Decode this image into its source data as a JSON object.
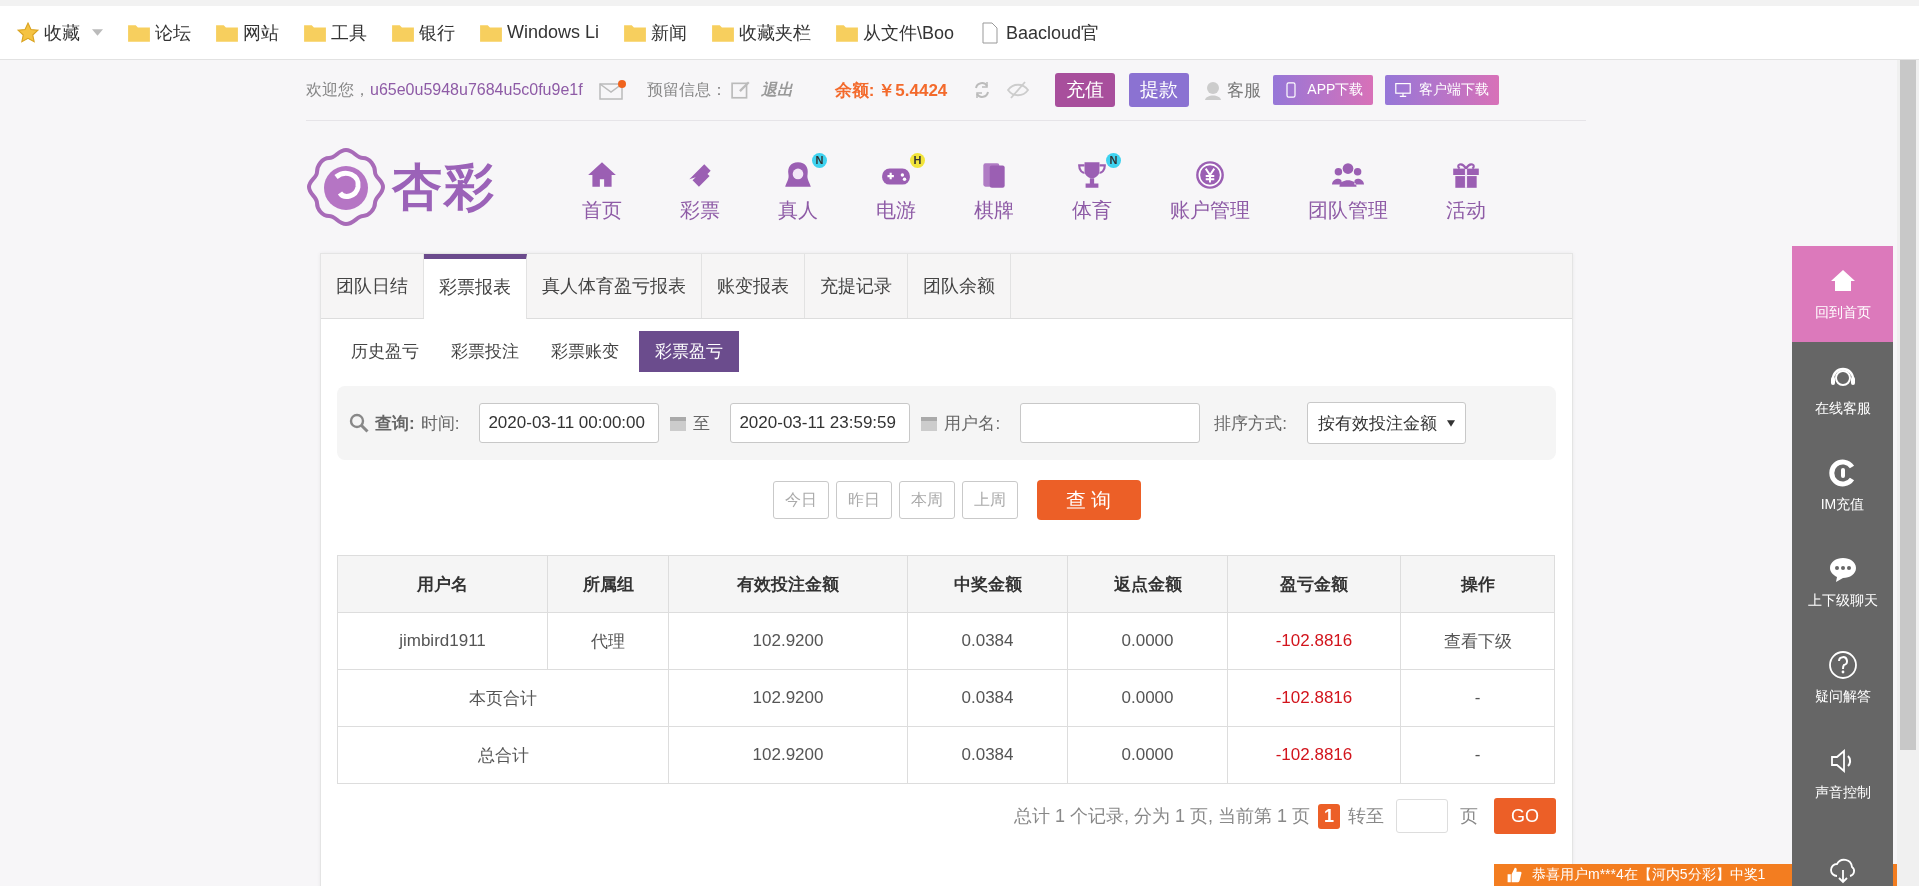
{
  "bookmarks": [
    {
      "label": "收藏",
      "kind": "star"
    },
    {
      "label": "论坛",
      "kind": "folder"
    },
    {
      "label": "网站",
      "kind": "folder"
    },
    {
      "label": "工具",
      "kind": "folder"
    },
    {
      "label": "银行",
      "kind": "folder"
    },
    {
      "label": "Windows Li",
      "kind": "folder"
    },
    {
      "label": "新闻",
      "kind": "folder"
    },
    {
      "label": "收藏夹栏",
      "kind": "folder"
    },
    {
      "label": "从文件\\Boo",
      "kind": "folder"
    },
    {
      "label": "Baacloud官",
      "kind": "page"
    }
  ],
  "top_bar": {
    "welcome": "欢迎您，",
    "username": "u65e0u5948u7684u5c0fu9e1f",
    "mail_unread": true,
    "reserved_label": "预留信息：",
    "logout": "退出",
    "balance_label": "余额:",
    "balance": "￥5.4424",
    "actions": [
      {
        "label": "充值",
        "kind": "recharge"
      },
      {
        "label": "提款",
        "kind": "withdraw"
      }
    ],
    "service": "客服",
    "downloads": [
      {
        "label": "APP下载",
        "kind": "phone"
      },
      {
        "label": "客户端下载",
        "kind": "desktop"
      }
    ]
  },
  "nav": {
    "logo": "杏彩",
    "items": [
      {
        "label": "首页"
      },
      {
        "label": "彩票"
      },
      {
        "label": "真人",
        "badge": {
          "text": "N",
          "color": "#3fd3f0"
        }
      },
      {
        "label": "电游",
        "badge": {
          "text": "H",
          "color": "#f2e43a"
        }
      },
      {
        "label": "棋牌"
      },
      {
        "label": "体育",
        "badge": {
          "text": "N",
          "color": "#3fd3f0"
        }
      },
      {
        "label": "账户管理"
      },
      {
        "label": "团队管理"
      },
      {
        "label": "活动"
      }
    ]
  },
  "tabs": [
    {
      "label": "团队日结",
      "selected": false
    },
    {
      "label": "彩票报表",
      "selected": true
    },
    {
      "label": "真人体育盈亏报表",
      "selected": false
    },
    {
      "label": "账变报表",
      "selected": false
    },
    {
      "label": "充提记录",
      "selected": false
    },
    {
      "label": "团队余额",
      "selected": false
    }
  ],
  "subtabs": [
    {
      "label": "历史盈亏",
      "selected": false
    },
    {
      "label": "彩票投注",
      "selected": false
    },
    {
      "label": "彩票账变",
      "selected": false
    },
    {
      "label": "彩票盈亏",
      "selected": true
    }
  ],
  "filter": {
    "query_label": "查询:",
    "time_label": "时间:",
    "start": "2020-03-11 00:00:00",
    "to": "至",
    "end": "2020-03-11 23:59:59",
    "username_label": "用户名:",
    "sort_label": "排序方式:",
    "sort_value": "按有效投注金额"
  },
  "quick_ranges": [
    "今日",
    "昨日",
    "本周",
    "上周"
  ],
  "search_button": "查 询",
  "table": {
    "columns": [
      {
        "label": "用户名",
        "kind": "plain"
      },
      {
        "label": "所属组",
        "kind": "plain"
      },
      {
        "label": "有效投注金额",
        "kind": "plain"
      },
      {
        "label": "中奖金额",
        "kind": "plain"
      },
      {
        "label": "返点金额",
        "kind": "plain"
      },
      {
        "label": "盈亏金额",
        "kind": "loss"
      },
      {
        "label": "操作",
        "kind": "plain"
      }
    ],
    "rows": [
      {
        "cells": [
          {
            "text": "jimbird1911"
          },
          {
            "text": "代理"
          },
          {
            "text": "102.9200"
          },
          {
            "text": "0.0384"
          },
          {
            "text": "0.0000"
          },
          {
            "text": "-102.8816"
          },
          {
            "text": "查看下级"
          }
        ]
      },
      {
        "cells": [
          {
            "text": "本页合计",
            "colspan": 2
          },
          {
            "text": "102.9200"
          },
          {
            "text": "0.0384"
          },
          {
            "text": "0.0000"
          },
          {
            "text": "-102.8816"
          },
          {
            "text": "-"
          }
        ]
      },
      {
        "cells": [
          {
            "text": "总合计",
            "colspan": 2
          },
          {
            "text": "102.9200"
          },
          {
            "text": "0.0384"
          },
          {
            "text": "0.0000"
          },
          {
            "text": "-102.8816"
          },
          {
            "text": "-"
          }
        ]
      }
    ]
  },
  "pagination": {
    "summary": "总计 1 个记录, 分为 1 页, 当前第 1 页",
    "current": "1",
    "goto": "转至",
    "unit": "页",
    "go": "GO"
  },
  "sidebar": [
    {
      "label": "回到首页",
      "selected": true
    },
    {
      "label": "在线客服",
      "selected": false
    },
    {
      "label": "IM充值",
      "selected": false
    },
    {
      "label": "上下级聊天",
      "selected": false
    },
    {
      "label": "疑问解答",
      "selected": false
    },
    {
      "label": "声音控制",
      "selected": false
    },
    {
      "selected": false
    }
  ],
  "ticker": "恭喜用户m***4在【河内5分彩】中奖1"
}
